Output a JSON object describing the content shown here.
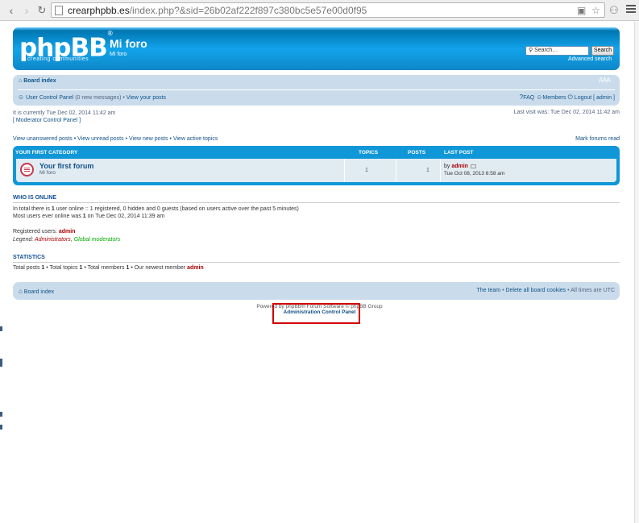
{
  "browser": {
    "url_host": "crearphpbb.es",
    "url_rest": "/index.php?&sid=26b02af222f897c380bc5e57e00d0f95"
  },
  "header": {
    "logo": "phpBB",
    "logo_mark": "®",
    "logo_tagline": "creating communities",
    "site_title": "Mi foro",
    "site_description": "Mi foro",
    "search_placeholder": "Search…",
    "search_button": "Search",
    "advanced_search": "Advanced search"
  },
  "navbar": {
    "breadcrumb": "Board index",
    "font_size": "A A A",
    "ucp_link": "User Control Panel",
    "new_messages": "(0 new messages)",
    "bullet": " • ",
    "view_posts": "View your posts",
    "faq": "FAQ",
    "members": "Members",
    "logout": "Logout [ admin ]"
  },
  "status": {
    "current_time": "It is currently Tue Dec 02, 2014 11:42 am",
    "mcp": "[ Moderator Control Panel ]",
    "last_visit": "Last visit was: Tue Dec 02, 2014 11:42 am"
  },
  "quick_links": {
    "unanswered": "View unanswered posts",
    "unread": "View unread posts",
    "new_posts": "View new posts",
    "active": "View active topics",
    "separator": " • ",
    "mark_read": "Mark forums read"
  },
  "category": {
    "title": "YOUR FIRST CATEGORY",
    "col_topics": "TOPICS",
    "col_posts": "POSTS",
    "col_last_post": "LAST POST",
    "forum": {
      "name": "Your first forum",
      "description": "Mi foro",
      "topics": "1",
      "posts": "1",
      "last_by_prefix": "by ",
      "last_by_user": "admin",
      "last_date": "Tue Oct 08, 2013 6:58 am"
    }
  },
  "who_is_online": {
    "title": "WHO IS ONLINE",
    "line1_pre": "In total there is ",
    "line1_count": "1",
    "line1_post": " user online :: 1 registered, 0 hidden and 0 guests (based on users active over the past 5 minutes)",
    "line2_pre": "Most users ever online was ",
    "line2_count": "1",
    "line2_post": " on Tue Dec 02, 2014 11:39 am",
    "registered_label": "Registered users: ",
    "registered_user": "admin",
    "legend_label": "Legend: ",
    "legend_admins": "Administrators",
    "legend_sep": ", ",
    "legend_gm": "Global moderators"
  },
  "statistics": {
    "title": "STATISTICS",
    "posts_label": "Total posts ",
    "posts": "1",
    "topics_label": " • Total topics ",
    "topics": "1",
    "members_label": " • Total members ",
    "members": "1",
    "newest_label": " • Our newest member ",
    "newest": "admin"
  },
  "footer": {
    "breadcrumb": "Board index",
    "team": "The team",
    "delete_cookies": "Delete all board cookies",
    "times": "All times are UTC",
    "separator": " • ",
    "copyright": "Powered by phpBB® Forum Software © phpBB Group",
    "acp": "Administration Control Panel"
  },
  "colors": {
    "header_blue": "#12a3eb",
    "nav_bg": "#cadceb",
    "link": "#105289",
    "admin_red": "#aa0000",
    "highlight_red": "#d10000"
  }
}
